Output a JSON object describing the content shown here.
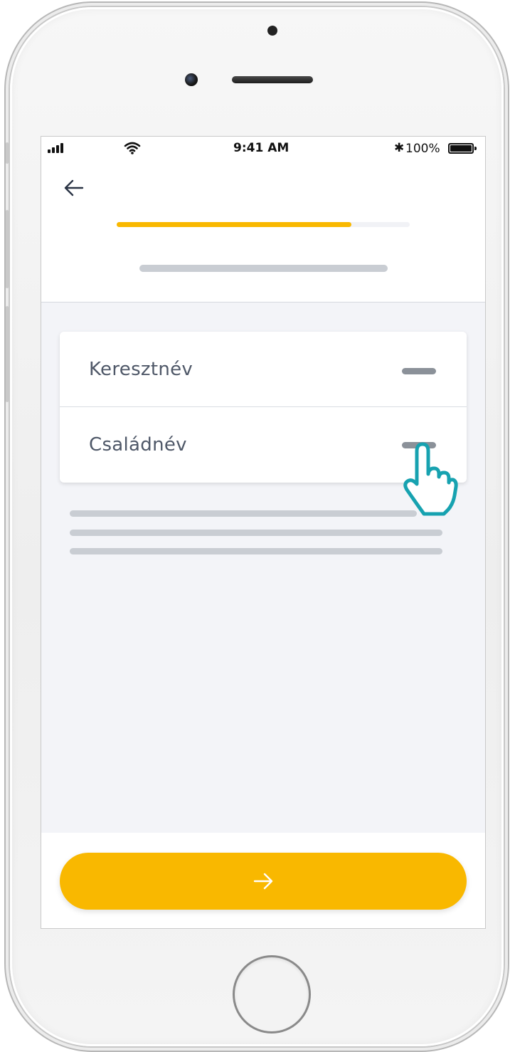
{
  "status_bar": {
    "time": "9:41 AM",
    "battery_percent_label": "100%",
    "battery_level": 1.0,
    "icons": [
      "signal-icon",
      "wifi-icon",
      "bluetooth-icon",
      "battery-icon"
    ]
  },
  "header": {
    "back_icon": "arrow-left-icon",
    "progress_fraction": 0.8
  },
  "form": {
    "rows": [
      {
        "label": "Keresztnév"
      },
      {
        "label": "Családnév"
      }
    ]
  },
  "footer": {
    "next_icon": "arrow-right-icon"
  },
  "colors": {
    "accent": "#f9b800",
    "screen_bg": "#f3f4f8",
    "text": "#4f5868",
    "placeholder": "#c9cdd3",
    "pointer": "#17a2b0"
  }
}
